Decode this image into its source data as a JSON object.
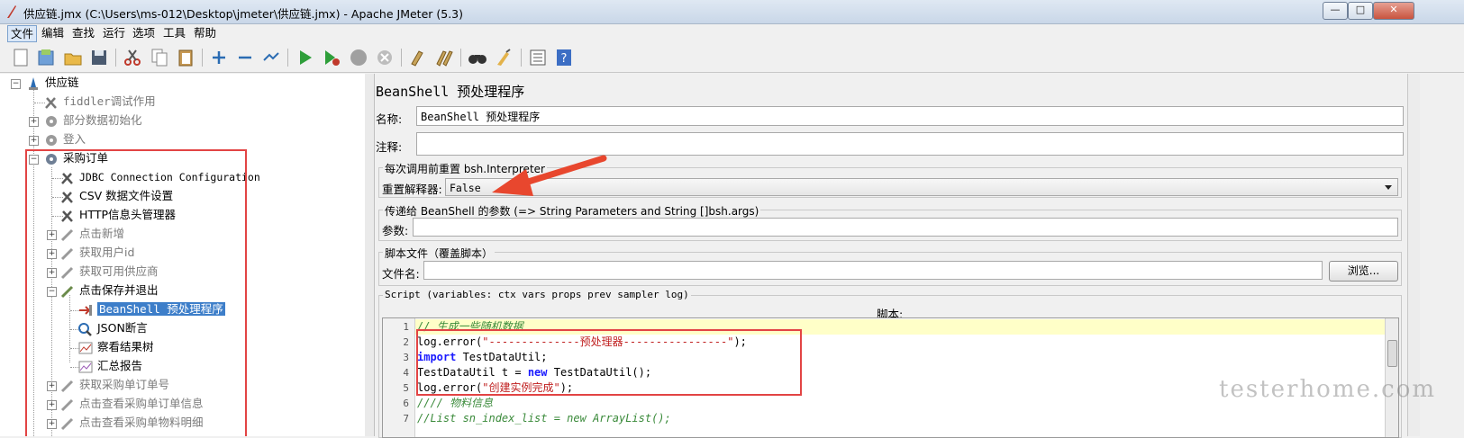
{
  "window": {
    "title": "供应链.jmx (C:\\Users\\ms-012\\Desktop\\jmeter\\供应链.jmx) - Apache JMeter (5.3)",
    "controls": [
      "—",
      "□",
      "✕"
    ]
  },
  "menu": [
    "文件",
    "编辑",
    "查找",
    "运行",
    "选项",
    "工具",
    "帮助"
  ],
  "toolbar_icons": [
    "new-icon",
    "templates-icon",
    "open-icon",
    "save-icon",
    "cut-icon",
    "copy-icon",
    "paste-icon",
    "expand-icon",
    "collapse-icon",
    "toggle-icon",
    "start-icon",
    "start-no-pause-icon",
    "stop-icon",
    "shutdown-icon",
    "clear-icon",
    "clear-all-icon",
    "search-icon",
    "reset-search-icon",
    "function-helper-icon",
    "help-icon"
  ],
  "tree": {
    "root": "供应链",
    "nodes": [
      {
        "label": "fiddler调试作用",
        "dim": true
      },
      {
        "label": "部分数据初始化",
        "dim": true
      },
      {
        "label": "登入",
        "dim": true
      },
      {
        "label": "采购订单",
        "dim": false
      },
      {
        "label": "JDBC Connection Configuration",
        "dim": false
      },
      {
        "label": "CSV 数据文件设置",
        "dim": false
      },
      {
        "label": "HTTP信息头管理器",
        "dim": false
      },
      {
        "label": "点击新增",
        "dim": true
      },
      {
        "label": "获取用户id",
        "dim": true
      },
      {
        "label": "获取可用供应商",
        "dim": true
      },
      {
        "label": "点击保存并退出",
        "dim": false
      },
      {
        "label": "BeanShell 预处理程序",
        "dim": false
      },
      {
        "label": "JSON断言",
        "dim": false
      },
      {
        "label": "察看结果树",
        "dim": false
      },
      {
        "label": "汇总报告",
        "dim": false
      },
      {
        "label": "获取采购单订单号",
        "dim": true
      },
      {
        "label": "点击查看采购单订单信息",
        "dim": true
      },
      {
        "label": "点击查看采购单物料明细",
        "dim": true
      }
    ]
  },
  "panel": {
    "title": "BeanShell 预处理程序",
    "name_label": "名称:",
    "name_value": "BeanShell 预处理程序",
    "comment_label": "注释:",
    "comment_value": "",
    "reset_group_title": "每次调用前重置 bsh.Interpreter",
    "reset_label": "重置解释器:",
    "reset_value": "False",
    "params_group_title": "传递给 BeanShell 的参数 (=> String Parameters and String []bsh.args)",
    "params_label": "参数:",
    "params_value": "",
    "file_group_title": "脚本文件（覆盖脚本）",
    "file_label": "文件名:",
    "file_value": "",
    "browse_label": "浏览...",
    "script_group_title": "Script (variables: ctx vars props prev sampler log)",
    "script_label": "脚本:"
  },
  "script_lines": [
    "1",
    "2",
    "3",
    "4",
    "5",
    "6",
    "7"
  ],
  "script_text": {
    "l1": "// 生成一些随机数据",
    "l2a": "log.error(",
    "l2s": "\"--------------预处理器----------------\"",
    "l2b": ");",
    "l3k": "import",
    "l3b": " TestDataUtil;",
    "l4a": "TestDataUtil t = ",
    "l4k": "new",
    "l4b": " TestDataUtil();",
    "l5a": "log.error(",
    "l5s": "\"创建实例完成\"",
    "l5b": ");",
    "l6": "//// 物料信息",
    "l7": "//List sn_index_list = new ArrayList();"
  },
  "watermark": "testerhome.com",
  "colors": {
    "selection": "#3d7ec9",
    "highlight_box": "#e24444",
    "arrow": "#e8472e"
  }
}
